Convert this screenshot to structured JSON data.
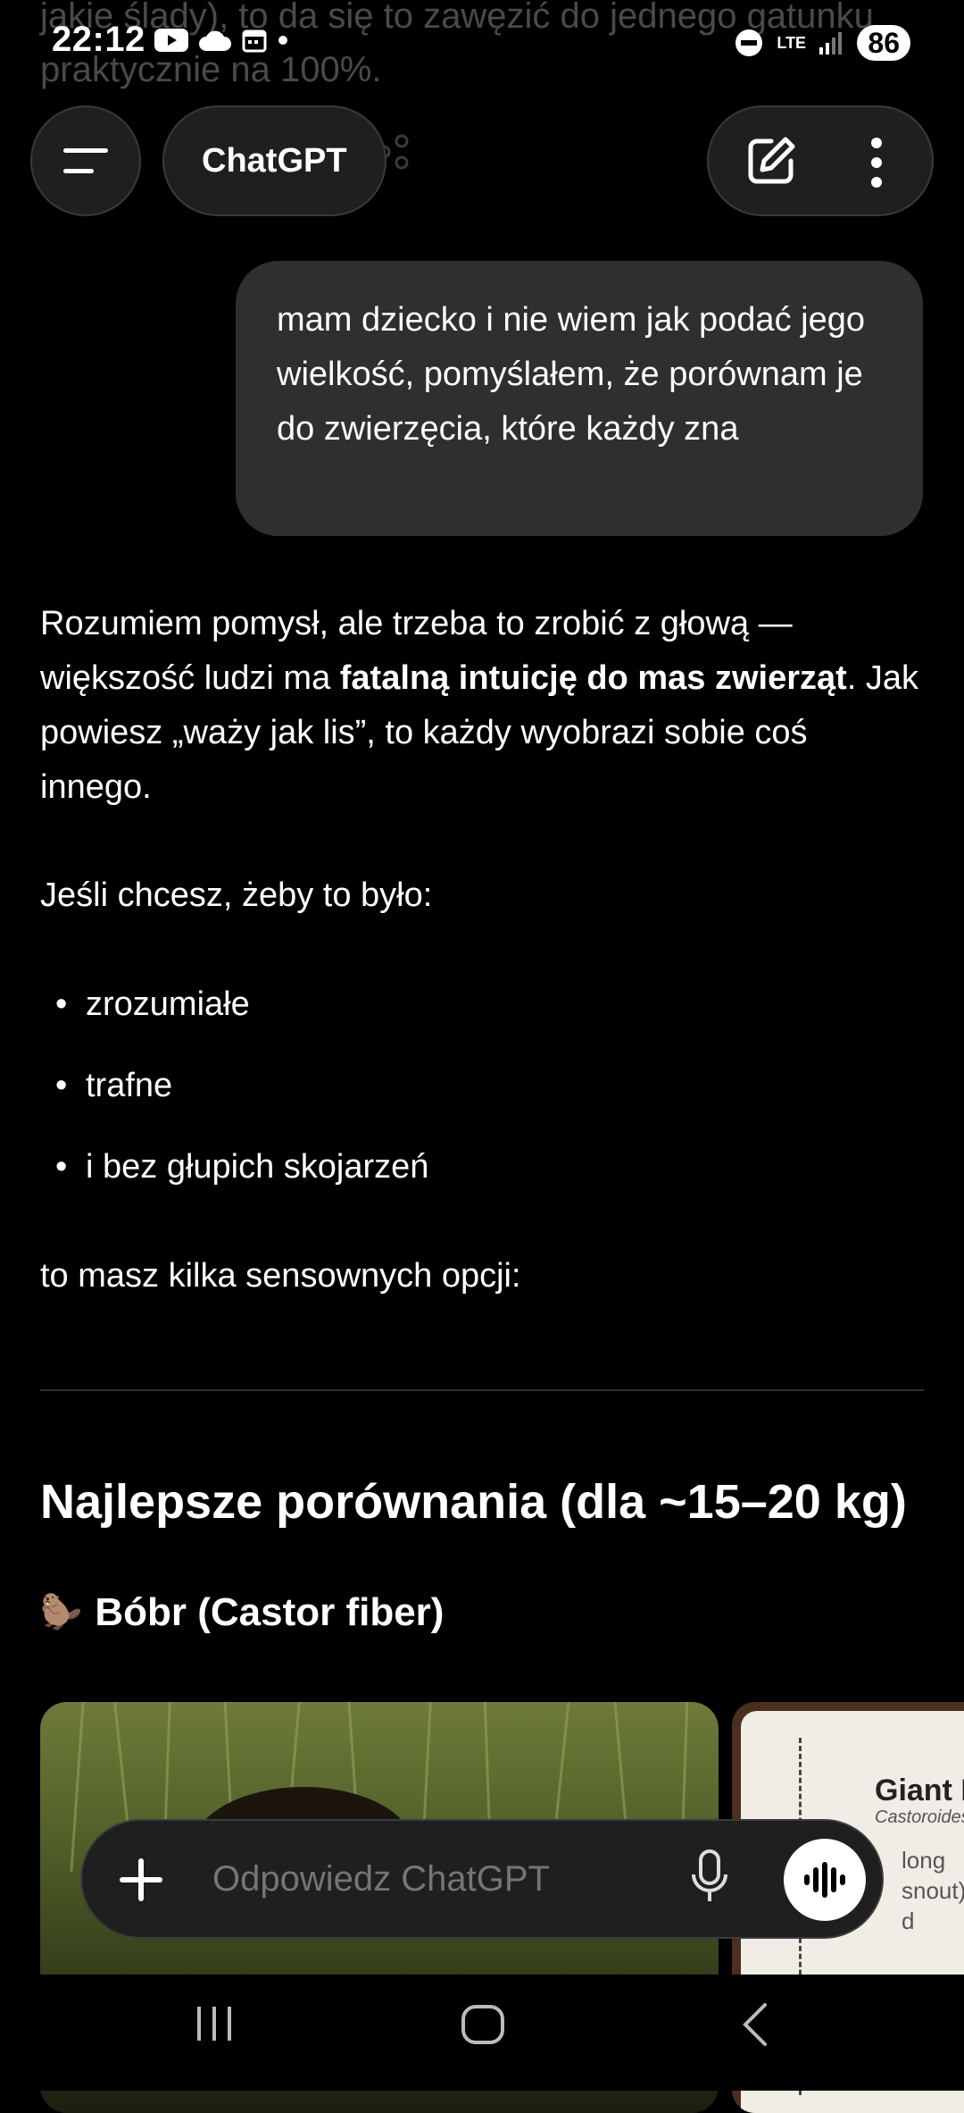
{
  "ghost_text": "jakie ślady), to da się to zawęzić do jednego gatunku praktycznie na 100%.",
  "status_bar": {
    "time": "22:12",
    "battery": "86",
    "network": "LTE"
  },
  "header": {
    "title": "ChatGPT"
  },
  "user_message": "mam dziecko i nie wiem jak podać jego wielkość, pomyślałem, że porównam je do zwierzęcia, które każdy zna",
  "assistant": {
    "p1_start": "Rozumiem pomysł, ale trzeba to zrobić z głową — większość ludzi ma ",
    "p1_bold": "fatalną intuicję do mas zwierząt",
    "p1_end": ". Jak powiesz „waży jak lis”, to każdy wyobrazi sobie coś innego.",
    "p2": "Jeśli chcesz, żeby to było:",
    "bullets": [
      "zrozumiałe",
      "trafne",
      "i bez głupich skojarzeń"
    ],
    "p3": "to masz kilka sensownych opcji:",
    "heading": "Najlepsze porównania (dla ~15–20 kg)",
    "subheading_emoji": "🦫",
    "subheading": "Bóbr (Castor fiber)"
  },
  "image2": {
    "title": "Giant B",
    "subtitle": "Castoroides",
    "line1": "long",
    "line2": "snout)",
    "line3": "d"
  },
  "input": {
    "placeholder": "Odpowiedz ChatGPT"
  },
  "colors": {
    "background": "#000000",
    "bubble": "#2f2f2f",
    "pill": "#1f1f1f",
    "text": "#ffffff",
    "placeholder": "#9a9a9a"
  }
}
